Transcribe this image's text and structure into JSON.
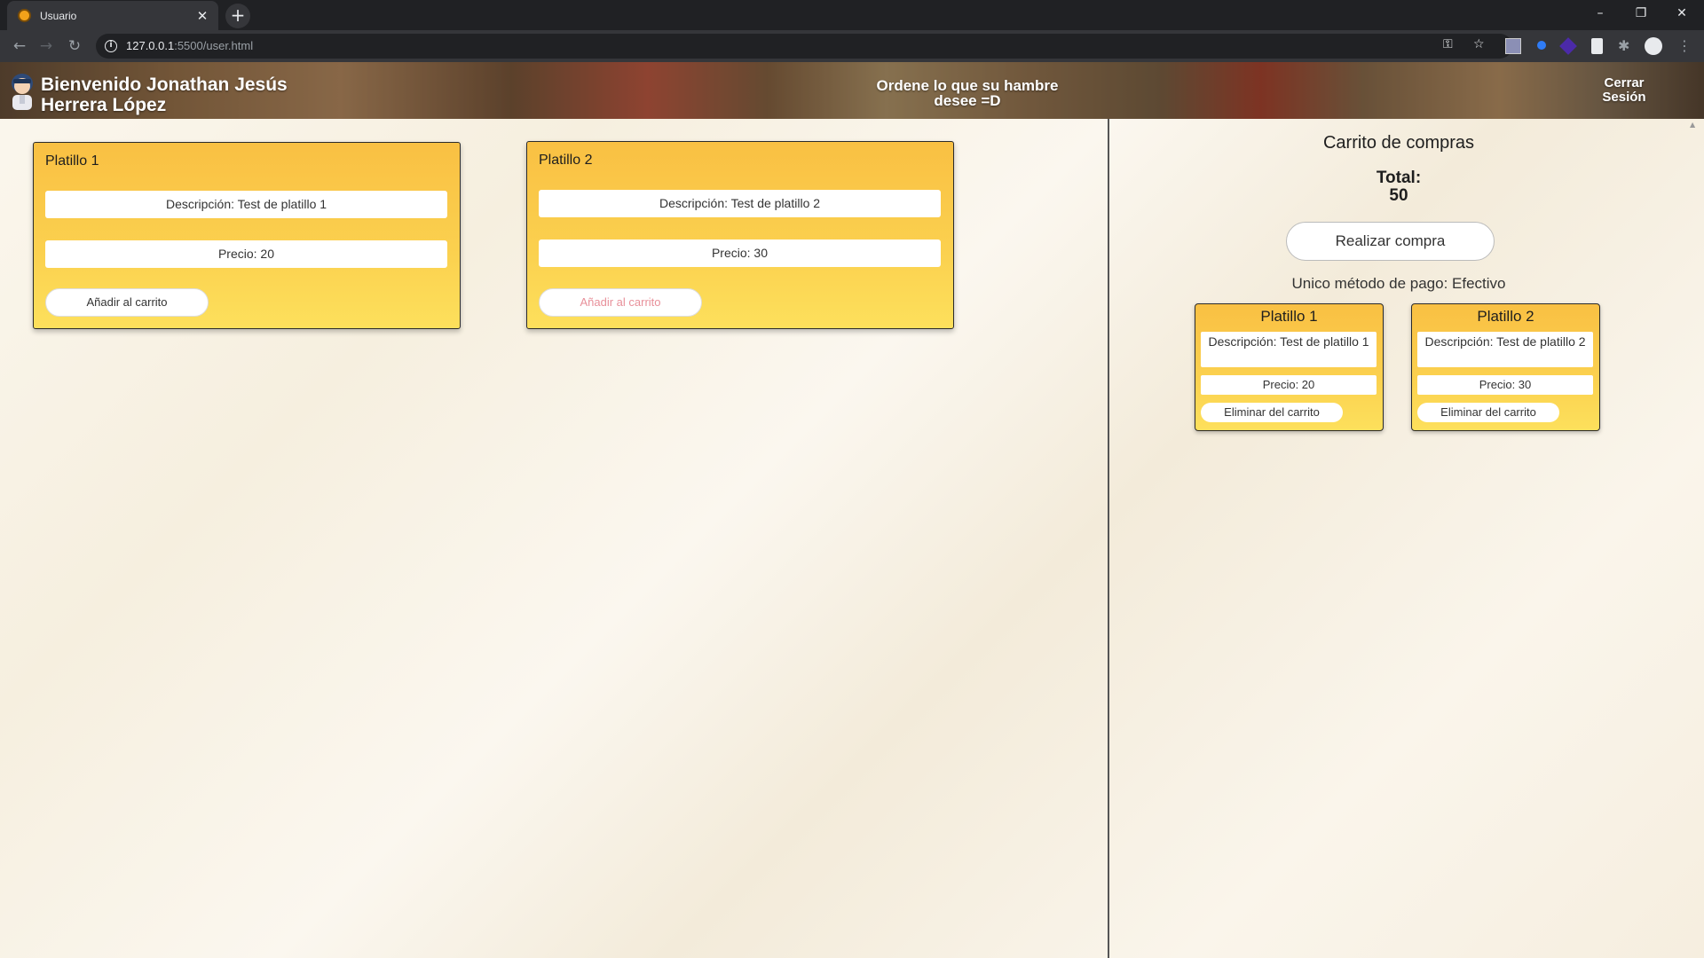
{
  "browser": {
    "tab_title": "Usuario",
    "tab_close": "✕",
    "new_tab": "+",
    "url_host": "127.0.0.1",
    "url_rest": ":5500/user.html",
    "window_controls": {
      "minimize": "–",
      "restore": "❐",
      "close": "✕"
    }
  },
  "header": {
    "welcome": "Bienvenido Jonathan Jesús Herrera López",
    "tagline": "Ordene lo que su hambre desee =D",
    "logout": "Cerrar Sesión"
  },
  "products": [
    {
      "title": "Platillo 1",
      "description": "Descripción: Test de platillo 1",
      "price": "Precio: 20",
      "add_label": "Añadir al carrito",
      "add_enabled": true
    },
    {
      "title": "Platillo 2",
      "description": "Descripción: Test de platillo 2",
      "price": "Precio: 30",
      "add_label": "Añadir al carrito",
      "add_enabled": false
    }
  ],
  "cart": {
    "title": "Carrito de compras",
    "total_label": "Total:",
    "total_value": "50",
    "buy_label": "Realizar compra",
    "payment_note": "Unico método de pago: Efectivo",
    "items": [
      {
        "title": "Platillo 1",
        "description": "Descripción: Test de platillo 1",
        "price": "Precio: 20",
        "remove_label": "Eliminar del carrito"
      },
      {
        "title": "Platillo 2",
        "description": "Descripción: Test de platillo 2",
        "price": "Precio: 30",
        "remove_label": "Eliminar del carrito"
      }
    ]
  },
  "colors": {
    "card_top": "#f9c043",
    "card_bottom": "#fde05c",
    "disabled_text": "#e8909a"
  }
}
